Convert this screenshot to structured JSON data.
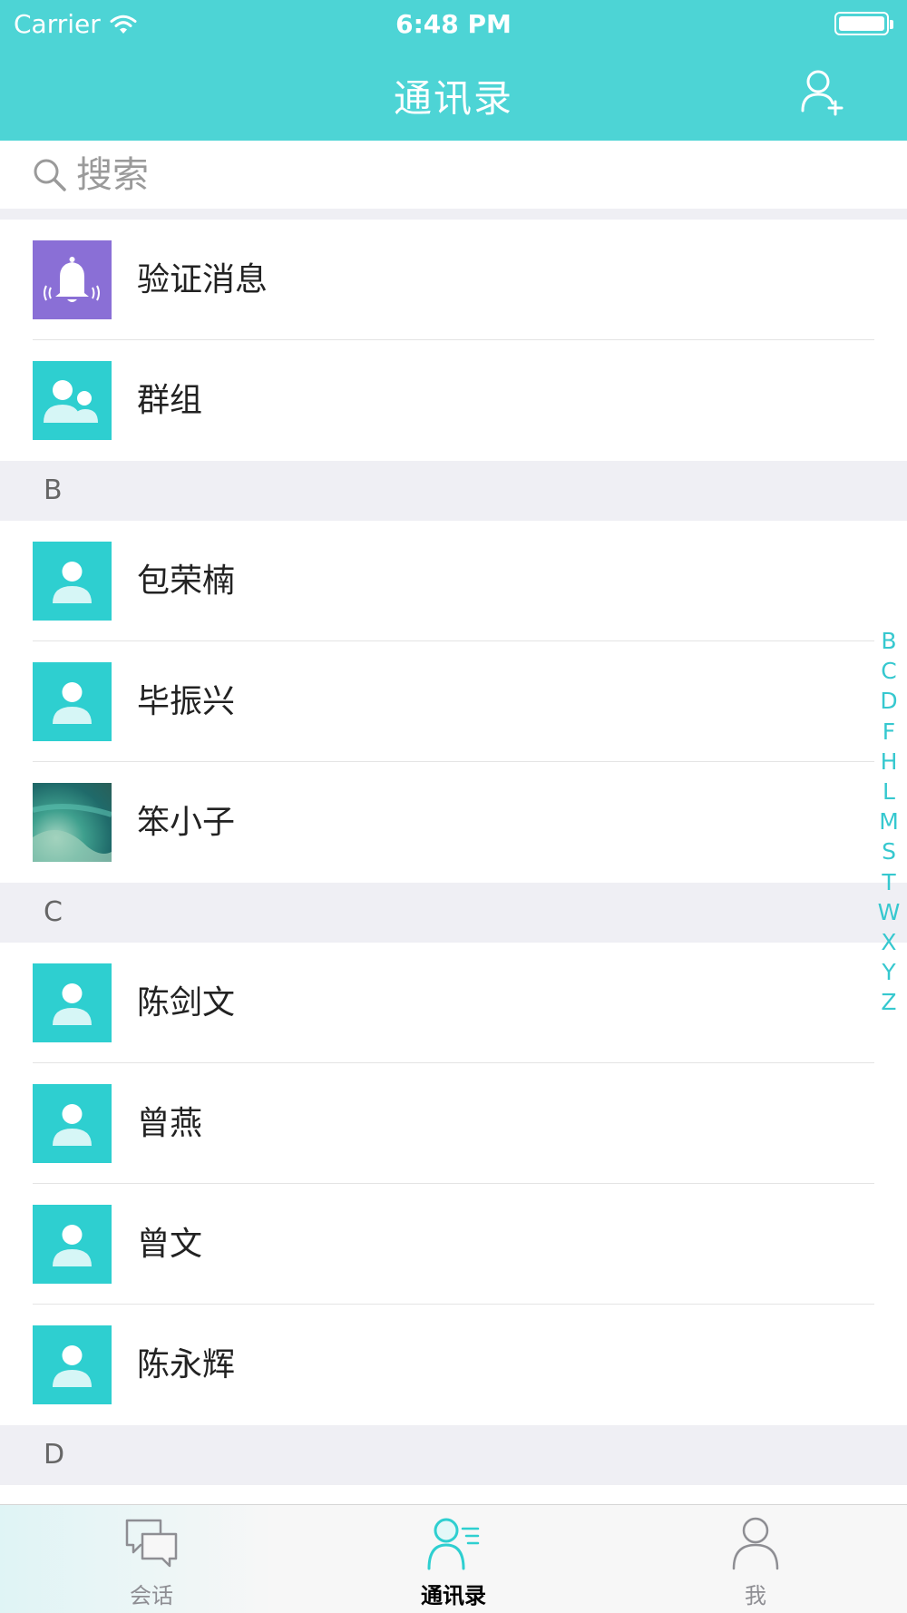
{
  "status_bar": {
    "carrier": "Carrier",
    "time": "6:48 PM"
  },
  "nav": {
    "title": "通讯录",
    "add_contact_icon": "add-user-icon"
  },
  "search": {
    "placeholder": "搜索",
    "value": ""
  },
  "top_items": [
    {
      "label": "验证消息",
      "icon": "bell-icon",
      "color": "#8a6fd6"
    },
    {
      "label": "群组",
      "icon": "group-icon",
      "color": "#2ecfd0"
    }
  ],
  "sections": [
    {
      "letter": "B",
      "contacts": [
        {
          "name": "包荣楠"
        },
        {
          "name": "毕振兴"
        },
        {
          "name": "笨小子"
        }
      ]
    },
    {
      "letter": "C",
      "contacts": [
        {
          "name": "陈剑文"
        },
        {
          "name": "曾燕"
        },
        {
          "name": "曾文"
        },
        {
          "name": "陈永辉"
        }
      ]
    },
    {
      "letter": "D",
      "contacts": []
    }
  ],
  "index_letters": [
    "B",
    "C",
    "D",
    "F",
    "H",
    "L",
    "M",
    "S",
    "T",
    "W",
    "X",
    "Y",
    "Z"
  ],
  "tabs": [
    {
      "label": "会话",
      "icon": "chat-bubbles-icon",
      "active": false
    },
    {
      "label": "通讯录",
      "icon": "contacts-icon",
      "active": true
    },
    {
      "label": "我",
      "icon": "person-icon",
      "active": false
    }
  ],
  "colors": {
    "accent": "#4dd4d5",
    "avatar": "#2ecfd0",
    "index": "#36c8cf",
    "section_bg": "#efeff4"
  }
}
